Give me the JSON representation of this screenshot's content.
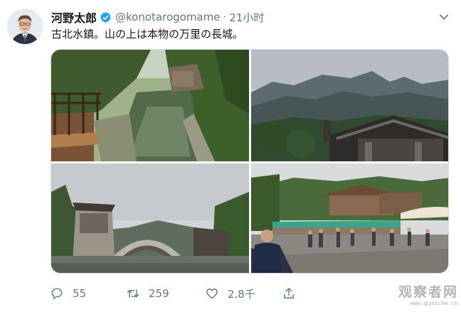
{
  "tweet": {
    "display_name": "河野太郎",
    "handle": "@konotarogomame",
    "separator": "·",
    "time": "21小时",
    "text": "古北水鎮。山の上は本物の万里の長城。",
    "verified": true
  },
  "media": {
    "photos": [
      {
        "subject": "canal-village"
      },
      {
        "subject": "mountain-rooftop"
      },
      {
        "subject": "arch-bridge"
      },
      {
        "subject": "plaza-crowd"
      }
    ]
  },
  "actions": {
    "reply_count": "55",
    "retweet_count": "259",
    "like_count": "2.8千"
  },
  "icons": {
    "verified": "verified-badge-icon",
    "caret": "chevron-down-icon",
    "reply": "reply-icon",
    "retweet": "retweet-icon",
    "like": "heart-icon",
    "share": "share-icon"
  },
  "watermark": {
    "main": "观察者网",
    "sub": "www.guancha.cn"
  },
  "colors": {
    "text": "#14171a",
    "secondary": "#657786",
    "verified": "#1da1f2",
    "border": "#d6dde2"
  }
}
